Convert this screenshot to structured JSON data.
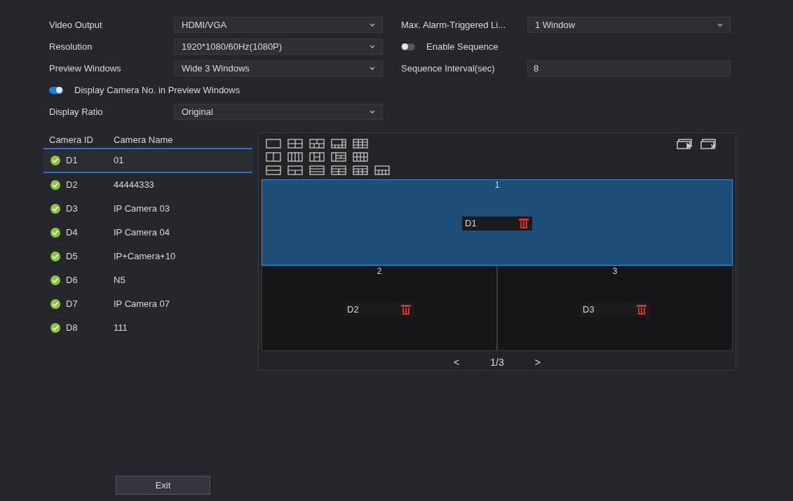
{
  "form_left": [
    {
      "kind": "select",
      "label": "Video Output",
      "value": "HDMI/VGA"
    },
    {
      "kind": "select",
      "label": "Resolution",
      "value": "1920*1080/60Hz(1080P)"
    },
    {
      "kind": "select",
      "label": "Preview Windows",
      "value": "Wide 3 Windows"
    },
    {
      "kind": "toggle",
      "label": "Display Camera No. in Preview Windows",
      "on": true
    },
    {
      "kind": "select",
      "label": "Display Ratio",
      "value": "Original"
    }
  ],
  "form_right": [
    {
      "kind": "select",
      "label": "Max. Alarm-Triggered Li...",
      "value": "1 Window"
    },
    {
      "kind": "toggle",
      "label": "Enable Sequence",
      "on": false
    },
    {
      "kind": "input",
      "label": "Sequence Interval(sec)",
      "value": "8"
    }
  ],
  "camera_table": {
    "columns": [
      "Camera ID",
      "Camera Name"
    ],
    "rows": [
      {
        "id": "D1",
        "name": "01",
        "selected": true
      },
      {
        "id": "D2",
        "name": "44444333",
        "selected": false
      },
      {
        "id": "D3",
        "name": "IP Camera 03",
        "selected": false
      },
      {
        "id": "D4",
        "name": "IP Camera 04",
        "selected": false
      },
      {
        "id": "D5",
        "name": "IP+Camera+10",
        "selected": false
      },
      {
        "id": "D6",
        "name": "N5",
        "selected": false
      },
      {
        "id": "D7",
        "name": "IP Camera 07",
        "selected": false
      },
      {
        "id": "D8",
        "name": "111",
        "selected": false
      }
    ]
  },
  "preview_windows": [
    {
      "number": "1",
      "camera": "D1",
      "selected": true
    },
    {
      "number": "2",
      "camera": "D2",
      "selected": false
    },
    {
      "number": "3",
      "camera": "D3",
      "selected": false
    }
  ],
  "pagination": {
    "prev": "<",
    "page": "1/3",
    "next": ">"
  },
  "buttons": [
    "Exit"
  ]
}
